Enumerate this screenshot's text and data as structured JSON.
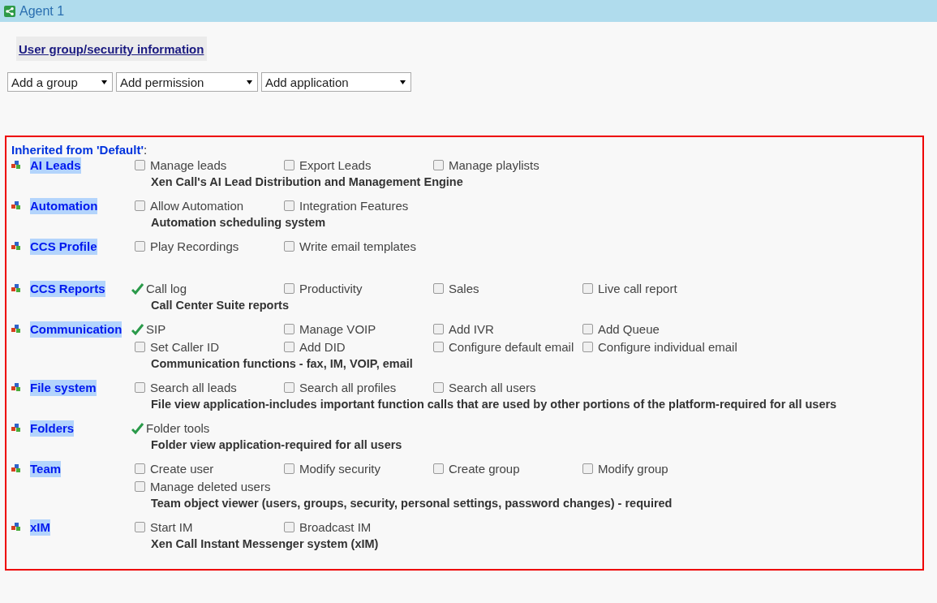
{
  "header": {
    "title": "Agent 1"
  },
  "section_button": "User group/security information",
  "dropdowns": [
    "Add a group",
    "Add permission",
    "Add application"
  ],
  "inherited": {
    "prefix": "Inherited from 'Default'",
    "suffix": ":"
  },
  "applications": [
    {
      "name": "AI Leads",
      "permissions": [
        {
          "label": "Manage leads",
          "checked": false
        },
        {
          "label": "Export Leads",
          "checked": false
        },
        {
          "label": "Manage playlists",
          "checked": false
        }
      ],
      "description": "Xen Call's AI Lead Distribution and Management Engine"
    },
    {
      "name": "Automation",
      "permissions": [
        {
          "label": "Allow Automation",
          "checked": false
        },
        {
          "label": "Integration Features",
          "checked": false
        }
      ],
      "description": "Automation scheduling system"
    },
    {
      "name": "CCS Profile",
      "permissions": [
        {
          "label": "Play Recordings",
          "checked": false
        },
        {
          "label": "Write email templates",
          "checked": false
        }
      ]
    },
    {
      "name": "CCS Reports",
      "permissions": [
        {
          "label": "Call log",
          "checked": true
        },
        {
          "label": "Productivity",
          "checked": false
        },
        {
          "label": "Sales",
          "checked": false
        },
        {
          "label": "Live call report",
          "checked": false
        }
      ],
      "description": "Call Center Suite reports"
    },
    {
      "name": "Communication",
      "permissions": [
        {
          "label": "SIP",
          "checked": true
        },
        {
          "label": "Manage VOIP",
          "checked": false
        },
        {
          "label": "Add IVR",
          "checked": false
        },
        {
          "label": "Add Queue",
          "checked": false
        },
        {
          "label": "Set Caller ID",
          "checked": false
        },
        {
          "label": "Add DID",
          "checked": false
        },
        {
          "label": "Configure default email",
          "checked": false
        },
        {
          "label": "Configure individual email",
          "checked": false
        }
      ],
      "description": "Communication functions - fax, IM, VOIP, email"
    },
    {
      "name": "File system",
      "permissions": [
        {
          "label": "Search all leads",
          "checked": false
        },
        {
          "label": "Search all profiles",
          "checked": false
        },
        {
          "label": "Search all users",
          "checked": false
        }
      ],
      "description": "File view application-includes important function calls that are used by other portions of the platform-required for all users"
    },
    {
      "name": "Folders",
      "permissions": [
        {
          "label": "Folder tools",
          "checked": true
        }
      ],
      "description": "Folder view application-required for all users"
    },
    {
      "name": "Team",
      "permissions": [
        {
          "label": "Create user",
          "checked": false
        },
        {
          "label": "Modify security",
          "checked": false
        },
        {
          "label": "Create group",
          "checked": false
        },
        {
          "label": "Modify group",
          "checked": false
        },
        {
          "label": "Manage deleted users",
          "checked": false
        }
      ],
      "description": "Team object viewer (users, groups, security, personal settings, password changes) - required"
    },
    {
      "name": "xIM",
      "permissions": [
        {
          "label": "Start IM",
          "checked": false
        },
        {
          "label": "Broadcast IM",
          "checked": false
        }
      ],
      "description": "Xen Call Instant Messenger system (xIM)"
    }
  ]
}
